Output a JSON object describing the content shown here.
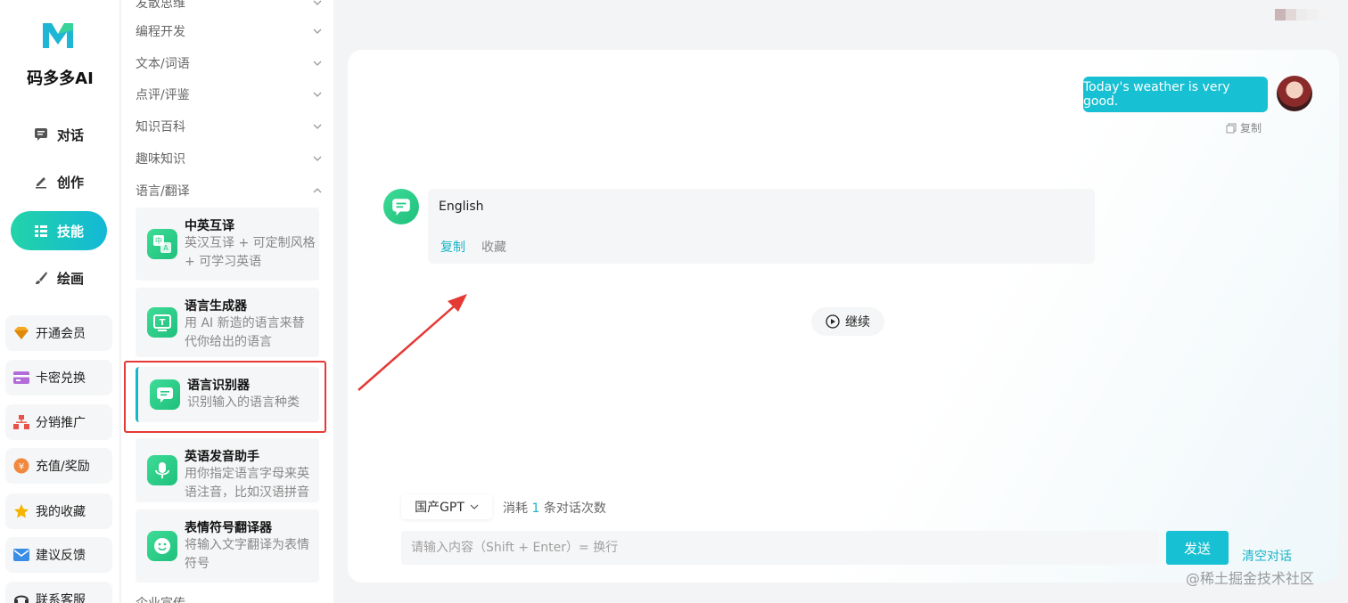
{
  "brand": {
    "name": "码多多AI"
  },
  "nav": {
    "items": [
      {
        "label": "对话",
        "icon": "chat-icon"
      },
      {
        "label": "创作",
        "icon": "pen-icon"
      },
      {
        "label": "技能",
        "icon": "list-icon",
        "active": true
      },
      {
        "label": "绘画",
        "icon": "brush-icon"
      }
    ]
  },
  "side_buttons": [
    {
      "label": "开通会员",
      "icon": "diamond-icon"
    },
    {
      "label": "卡密兑换",
      "icon": "card-icon"
    },
    {
      "label": "分销推广",
      "icon": "network-icon"
    },
    {
      "label": "充值/奖励",
      "icon": "coin-icon"
    },
    {
      "label": "我的收藏",
      "icon": "star-icon"
    },
    {
      "label": "建议反馈",
      "icon": "mail-icon"
    },
    {
      "label": "联系客服",
      "icon": "headset-icon"
    }
  ],
  "categories": [
    {
      "label": "发散思维"
    },
    {
      "label": "编程开发"
    },
    {
      "label": "文本/词语"
    },
    {
      "label": "点评/评鉴"
    },
    {
      "label": "知识百科"
    },
    {
      "label": "趣味知识"
    },
    {
      "label": "语言/翻译",
      "expanded": true
    },
    {
      "label": "企业宣传"
    }
  ],
  "skills": [
    {
      "title": "中英互译",
      "desc": "英汉互译 + 可定制风格 + 可学习英语",
      "icon": "translate-icon"
    },
    {
      "title": "语言生成器",
      "desc": "用 AI 新造的语言来替代你给出的语言",
      "icon": "text-tool-icon"
    },
    {
      "title": "语言识别器",
      "desc": "识别输入的语言种类",
      "icon": "chat-bubble-icon",
      "selected": true
    },
    {
      "title": "英语发音助手",
      "desc": "用你指定语言字母来英语注音，比如汉语拼音",
      "icon": "microphone-icon"
    },
    {
      "title": "表情符号翻译器",
      "desc": "将输入文字翻译为表情符号",
      "icon": "smiley-icon"
    }
  ],
  "chat": {
    "user_message": "Today's weather is very good.",
    "user_copy_label": "复制",
    "bot_message": "English",
    "bot_copy_label": "复制",
    "bot_fav_label": "收藏",
    "continue_label": "继续"
  },
  "composer": {
    "model": "国产GPT",
    "consume_prefix": "消耗",
    "consume_count": "1",
    "consume_suffix": "条对话次数",
    "placeholder": "请输入内容（Shift + Enter）= 换行",
    "send_label": "发送",
    "clear_label": "清空对话"
  },
  "watermark": "@稀土掘金技术社区",
  "colors": {
    "accent": "#17c0d2",
    "green": "#22c985",
    "highlight": "#e53935"
  }
}
